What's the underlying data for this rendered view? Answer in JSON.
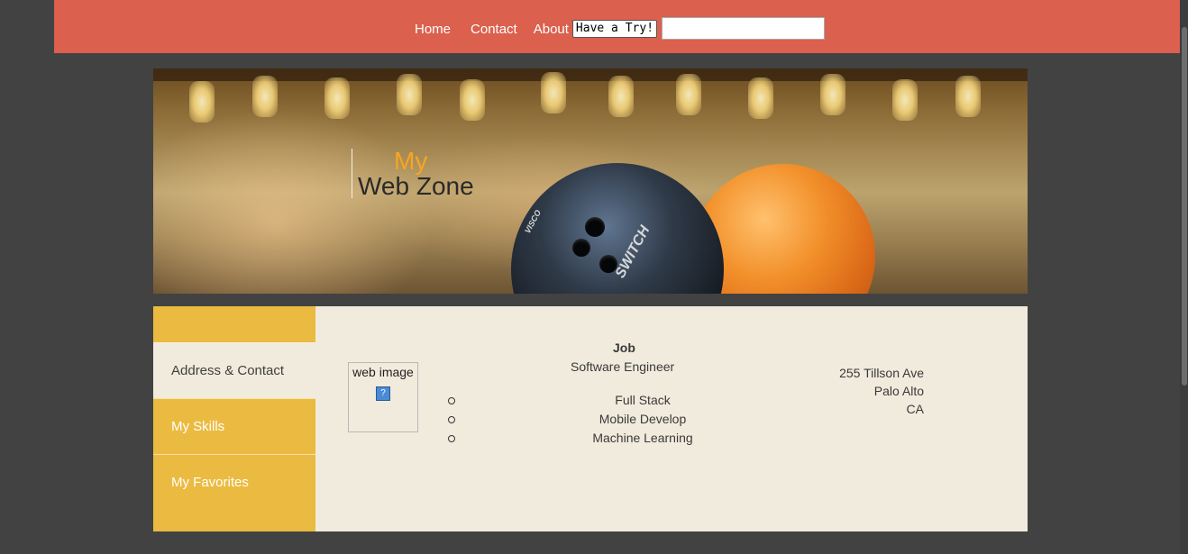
{
  "nav": {
    "home": "Home",
    "contact": "Contact",
    "about": "About",
    "try_button": "Have a Try!",
    "search_value": ""
  },
  "hero": {
    "title_line1": "My",
    "title_line2": "Web Zone",
    "ball_logo_text": "SWITCH",
    "ball_brand_text": "VISCO"
  },
  "sidebar": {
    "items": [
      {
        "label": "Address & Contact",
        "active": true
      },
      {
        "label": "My Skills",
        "active": false
      },
      {
        "label": "My Favorites",
        "active": false
      }
    ]
  },
  "content": {
    "image_alt": "web image",
    "broken_glyph": "?",
    "job_label": "Job",
    "job_value": "Software Engineer",
    "skills": [
      "Full Stack",
      "Mobile Develop",
      "Machine Learning"
    ],
    "address": [
      "255 Tillson Ave",
      "Palo Alto",
      "CA"
    ]
  },
  "colors": {
    "topbar": "#db604e",
    "background": "#424242",
    "sidebar": "#ebbb41",
    "panel": "#f1ebdd",
    "accent_title": "#f5a623"
  }
}
